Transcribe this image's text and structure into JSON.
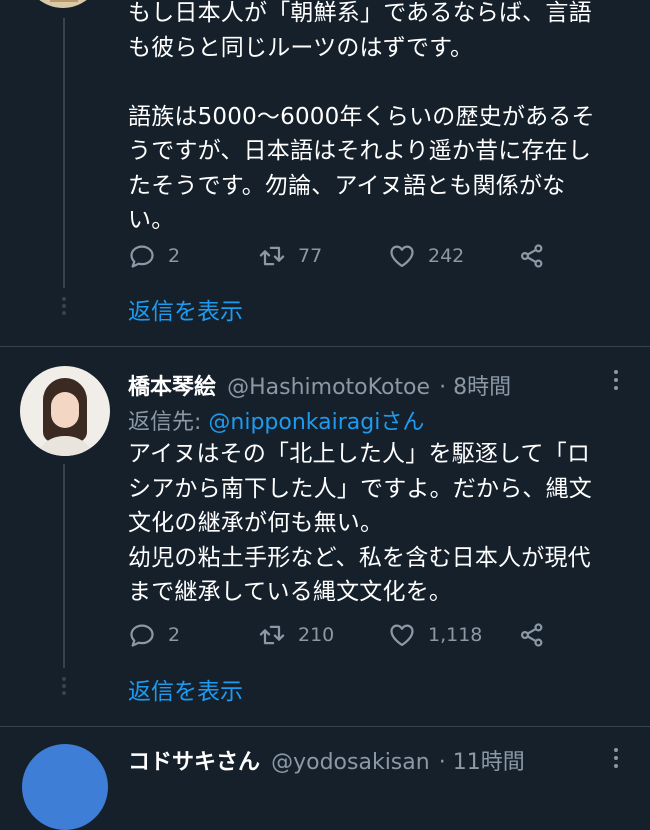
{
  "tweet1": {
    "text": "もし日本人が「朝鮮系」であるならば、言語\nも彼らと同じルーツのはずです。\n\n語族は5000〜6000年くらいの歴史があるそ\nうですが、日本語はそれより遥か昔に存在し\nたそうです。勿論、アイヌ語とも関係がな\nい。",
    "replies": "2",
    "retweets": "77",
    "likes": "242",
    "show_replies": "返信を表示"
  },
  "tweet2": {
    "name": "橋本琴絵",
    "handle": "@HashimotoKotoe",
    "time": "· 8時間",
    "reply_prefix": "返信先: ",
    "reply_mention": "@nipponkairagiさん",
    "text": "アイヌはその「北上した人」を駆逐して「ロ\nシアから南下した人」ですよ。だから、縄文\n文化の継承が何も無い。\n幼児の粘土手形など、私を含む日本人が現代\nまで継承している縄文文化を。",
    "replies": "2",
    "retweets": "210",
    "likes": "1,118",
    "show_replies": "返信を表示"
  },
  "tweet3": {
    "name": "コドサキさん",
    "handle": "@yodosakisan",
    "time": "· 11時間"
  },
  "icons": {
    "reply": "reply-icon",
    "retweet": "retweet-icon",
    "like": "heart-icon",
    "share": "share-icon",
    "more": "more-icon"
  },
  "colors": {
    "background": "#15202b",
    "link": "#1d9bf0",
    "secondary_text": "#8b98a5",
    "divider": "#38444d"
  }
}
